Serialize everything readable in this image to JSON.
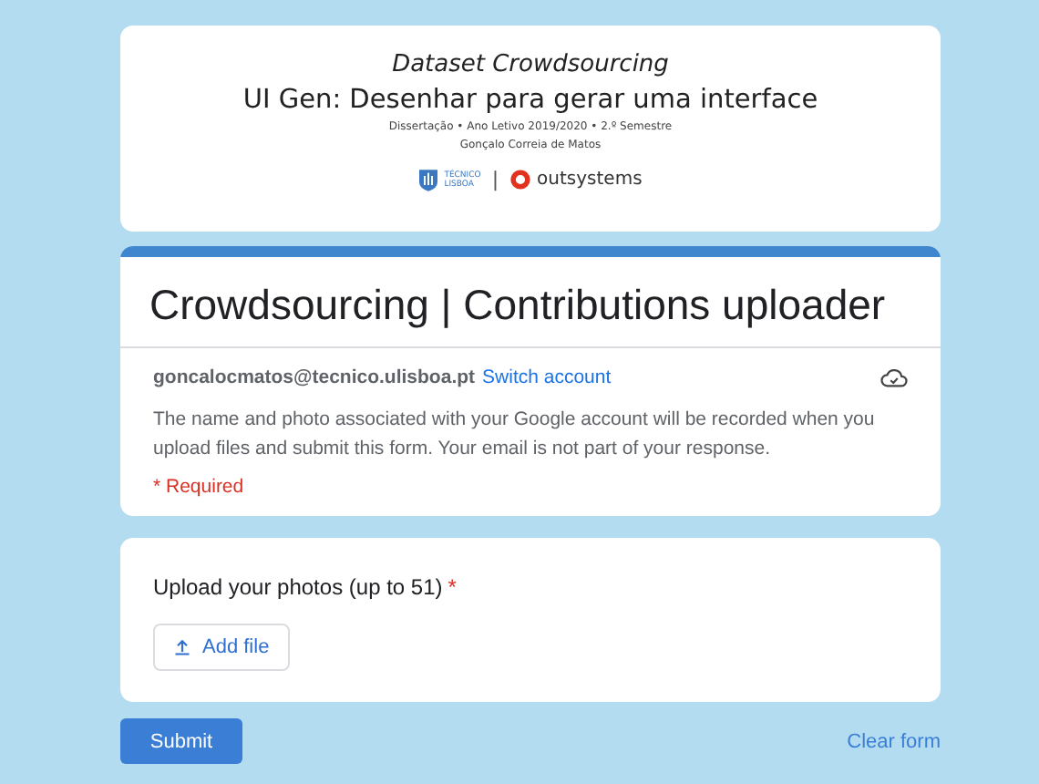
{
  "header": {
    "subtitle": "Dataset Crowdsourcing",
    "title": "UI Gen: Desenhar para gerar uma interface",
    "meta": "Dissertação • Ano Letivo 2019/2020 • 2.º Semestre",
    "author": "Gonçalo Correia de Matos",
    "logos": {
      "tecnico_line_1": "TÉCNICO",
      "tecnico_line_2": "LISBOA",
      "separator": "|",
      "outsystems": "outsystems"
    }
  },
  "form": {
    "title": "Crowdsourcing | Contributions uploader",
    "email": "goncalocmatos@tecnico.ulisboa.pt",
    "switch_account": "Switch account",
    "notice": "The name and photo associated with your Google account will be recorded when you upload files and submit this form. Your email is not part of your response.",
    "required_note": "* Required"
  },
  "question": {
    "label": "Upload your photos (up to 51)",
    "required_mark": "*",
    "button": "Add file"
  },
  "actions": {
    "submit": "Submit",
    "clear": "Clear form"
  }
}
